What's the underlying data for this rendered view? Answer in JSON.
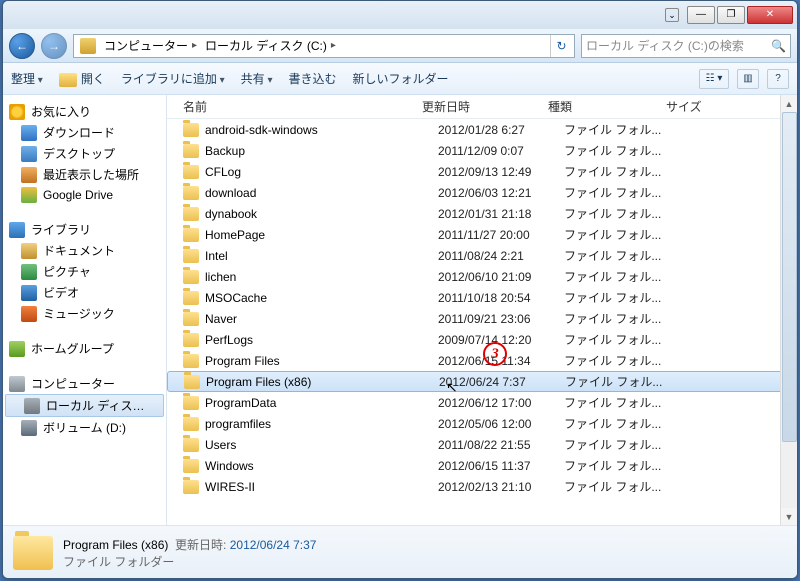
{
  "title_buttons": {
    "min": "—",
    "max": "❐",
    "close": "✕",
    "expand": "⌄"
  },
  "nav": {
    "back": "←",
    "fwd": "→"
  },
  "breadcrumbs": [
    {
      "label": "コンピューター"
    },
    {
      "label": "ローカル ディスク (C:)"
    }
  ],
  "search": {
    "placeholder": "ローカル ディスク (C:)の検索"
  },
  "toolbar": {
    "organize": "整理",
    "open": "開く",
    "library": "ライブラリに追加",
    "share": "共有",
    "burn": "書き込む",
    "newfolder": "新しいフォルダー"
  },
  "tree": {
    "fav": {
      "label": "お気に入り",
      "items": [
        "ダウンロード",
        "デスクトップ",
        "最近表示した場所",
        "Google Drive"
      ]
    },
    "lib": {
      "label": "ライブラリ",
      "items": [
        "ドキュメント",
        "ピクチャ",
        "ビデオ",
        "ミュージック"
      ]
    },
    "home": {
      "label": "ホームグループ"
    },
    "comp": {
      "label": "コンピューター",
      "items": [
        "ローカル ディス…",
        "ボリューム (D:)"
      ]
    }
  },
  "columns": {
    "name": "名前",
    "date": "更新日時",
    "type": "種類",
    "size": "サイズ"
  },
  "type_label": "ファイル フォル...",
  "rows": [
    {
      "name": "android-sdk-windows",
      "date": "2012/01/28 6:27"
    },
    {
      "name": "Backup",
      "date": "2011/12/09 0:07"
    },
    {
      "name": "CFLog",
      "date": "2012/09/13 12:49"
    },
    {
      "name": "download",
      "date": "2012/06/03 12:21"
    },
    {
      "name": "dynabook",
      "date": "2012/01/31 21:18"
    },
    {
      "name": "HomePage",
      "date": "2011/11/27 20:00"
    },
    {
      "name": "Intel",
      "date": "2011/08/24 2:21"
    },
    {
      "name": "lichen",
      "date": "2012/06/10 21:09"
    },
    {
      "name": "MSOCache",
      "date": "2011/10/18 20:54"
    },
    {
      "name": "Naver",
      "date": "2011/09/21 23:06"
    },
    {
      "name": "PerfLogs",
      "date": "2009/07/14 12:20"
    },
    {
      "name": "Program Files",
      "date": "2012/06/15 11:34",
      "callout": "3"
    },
    {
      "name": "Program Files (x86)",
      "date": "2012/06/24 7:37",
      "selected": true,
      "cursor": true
    },
    {
      "name": "ProgramData",
      "date": "2012/06/12 17:00"
    },
    {
      "name": "programfiles",
      "date": "2012/05/06 12:00"
    },
    {
      "name": "Users",
      "date": "2011/08/22 21:55"
    },
    {
      "name": "Windows",
      "date": "2012/06/15 11:37"
    },
    {
      "name": "WIRES-II",
      "date": "2012/02/13 21:10"
    }
  ],
  "details": {
    "name": "Program Files (x86)",
    "meta_label": "更新日時:",
    "date": "2012/06/24 7:37",
    "type": "ファイル フォルダー"
  }
}
